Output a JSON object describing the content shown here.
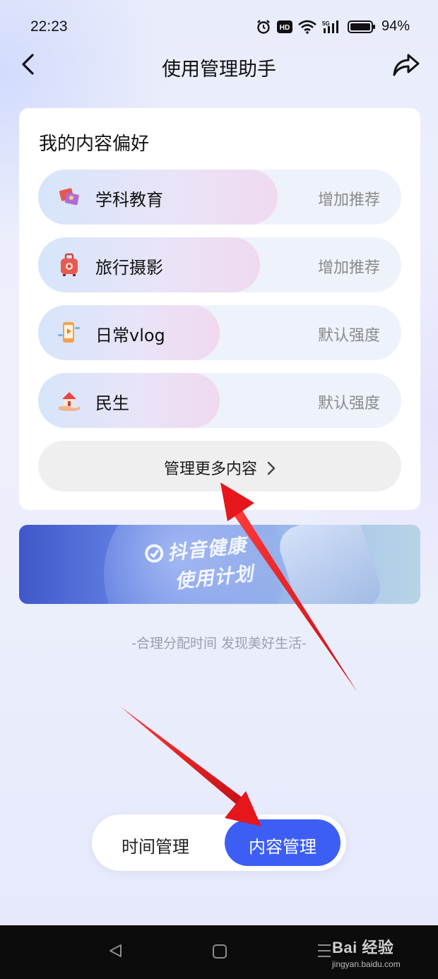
{
  "status_bar": {
    "time": "22:23",
    "network": "5G",
    "battery": "94%",
    "icons": [
      "alarm-icon",
      "hd-icon",
      "wifi-icon",
      "signal-5g-icon",
      "battery-icon"
    ]
  },
  "nav": {
    "title": "使用管理助手",
    "back_icon": "chevron-left-icon",
    "share_icon": "share-icon"
  },
  "preferences": {
    "title": "我的内容偏好",
    "items": [
      {
        "label": "学科教育",
        "action": "增加推荐",
        "icon": "education-icon",
        "level": 0.66
      },
      {
        "label": "旅行摄影",
        "action": "增加推荐",
        "icon": "suitcase-icon",
        "level": 0.61
      },
      {
        "label": "日常vlog",
        "action": "默认强度",
        "icon": "vlog-phone-icon",
        "level": 0.5
      },
      {
        "label": "民生",
        "action": "默认强度",
        "icon": "house-hand-icon",
        "level": 0.5
      }
    ],
    "more_label": "管理更多内容"
  },
  "banner": {
    "line1": "抖音健康",
    "line2": "使用计划"
  },
  "slogan": "-合理分配时间 发现美好生活-",
  "tabs": {
    "time_label": "时间管理",
    "content_label": "内容管理",
    "active": "content"
  },
  "watermark": {
    "brand": "Bai 经验",
    "url": "jingyan.baidu.com"
  },
  "colors": {
    "accent": "#3d5ef5",
    "arrow": "#e5161c",
    "card": "#ffffff"
  }
}
